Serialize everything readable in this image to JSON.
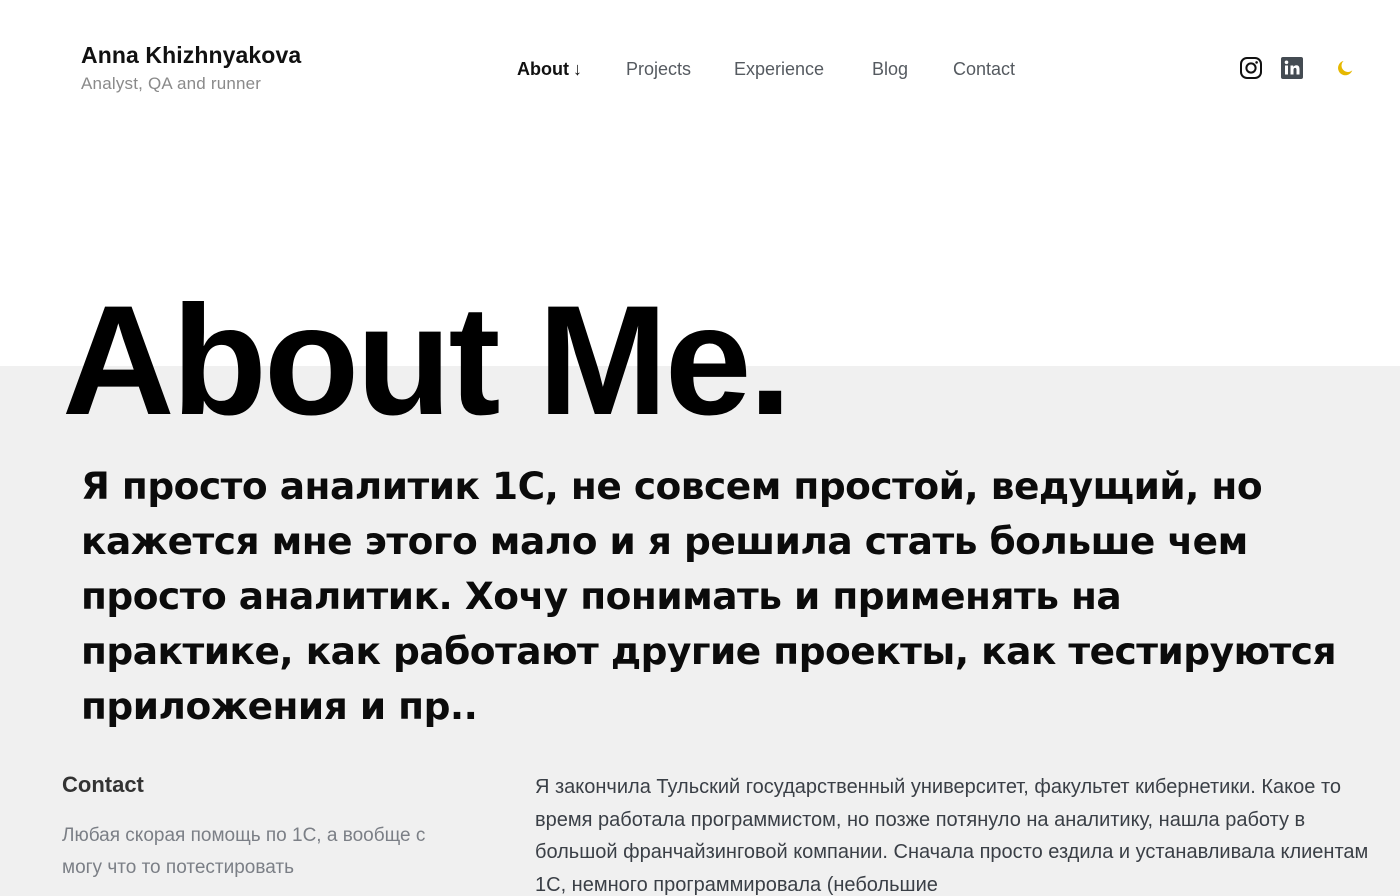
{
  "brand": {
    "name": "Anna Khizhnyakova",
    "tagline": "Analyst, QA and runner"
  },
  "nav": {
    "about": "About",
    "about_arrow": "↓",
    "projects": "Projects",
    "experience": "Experience",
    "blog": "Blog",
    "contact": "Contact"
  },
  "icons": {
    "social_1": "instagram-icon",
    "social_2": "linkedin-icon",
    "theme_toggle": "moon-icon"
  },
  "colors": {
    "accent_moon": "#e6b800",
    "band": "#f0f0f0"
  },
  "hero": {
    "title": "About Me."
  },
  "lead": {
    "text": "Я просто аналитик 1С, не совсем простой, ведущий, но кажется мне этого мало и я решила стать больше чем просто аналитик. Хочу понимать и применять на практике, как работают другие проекты, как тестируются приложения и пр.."
  },
  "contact_section": {
    "heading": "Contact",
    "text": "Любая скорая помощь по 1С, а вообще с могу что то потестировать"
  },
  "bio": {
    "text": "Я закончила Тульский государственный университет, факультет кибернетики. Какое то время работала программистом, но позже потянуло на аналитику, нашла работу в большой франчайзинговой компании. Сначала просто ездила и устанавливала клиентам 1С, немного программировала (небольшие"
  }
}
